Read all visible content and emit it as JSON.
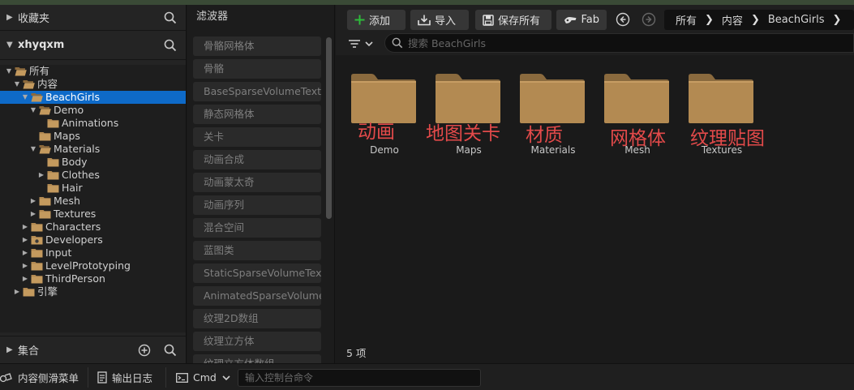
{
  "left_panel": {
    "favorites_title": "收藏夹",
    "project_title": "xhyqxm",
    "collections_title": "集合",
    "tree": [
      {
        "label": "所有",
        "depth": 0,
        "expander": "open",
        "icon": "folder-open-icon"
      },
      {
        "label": "内容",
        "depth": 1,
        "expander": "open",
        "icon": "folder-open-icon"
      },
      {
        "label": "BeachGirls",
        "depth": 2,
        "expander": "open",
        "icon": "folder-open-icon",
        "selected": true
      },
      {
        "label": "Demo",
        "depth": 3,
        "expander": "open",
        "icon": "folder-open-icon"
      },
      {
        "label": "Animations",
        "depth": 4,
        "expander": "none",
        "icon": "folder-icon"
      },
      {
        "label": "Maps",
        "depth": 3,
        "expander": "none",
        "icon": "folder-icon"
      },
      {
        "label": "Materials",
        "depth": 3,
        "expander": "open",
        "icon": "folder-open-icon"
      },
      {
        "label": "Body",
        "depth": 4,
        "expander": "none",
        "icon": "folder-icon"
      },
      {
        "label": "Clothes",
        "depth": 4,
        "expander": "closed",
        "icon": "folder-icon"
      },
      {
        "label": "Hair",
        "depth": 4,
        "expander": "none",
        "icon": "folder-icon"
      },
      {
        "label": "Mesh",
        "depth": 3,
        "expander": "closed",
        "icon": "folder-icon"
      },
      {
        "label": "Textures",
        "depth": 3,
        "expander": "closed",
        "icon": "folder-icon"
      },
      {
        "label": "Characters",
        "depth": 2,
        "expander": "closed",
        "icon": "folder-icon"
      },
      {
        "label": "Developers",
        "depth": 2,
        "expander": "closed",
        "icon": "folder-developer-icon"
      },
      {
        "label": "Input",
        "depth": 2,
        "expander": "closed",
        "icon": "folder-icon"
      },
      {
        "label": "LevelPrototyping",
        "depth": 2,
        "expander": "closed",
        "icon": "folder-icon"
      },
      {
        "label": "ThirdPerson",
        "depth": 2,
        "expander": "closed",
        "icon": "folder-icon"
      },
      {
        "label": "引擎",
        "depth": 1,
        "expander": "closed",
        "icon": "folder-icon"
      }
    ]
  },
  "filter_panel": {
    "title": "滤波器",
    "items": [
      "骨骼网格体",
      "骨骼",
      "BaseSparseVolumeTexture",
      "静态网格体",
      "关卡",
      "动画合成",
      "动画蒙太奇",
      "动画序列",
      "混合空间",
      "蓝图类",
      "StaticSparseVolumeTexture",
      "AnimatedSparseVolumeTexture",
      "纹理2D数组",
      "纹理立方体",
      "纹理立方体数组"
    ]
  },
  "toolbar": {
    "add_label": "添加",
    "import_label": "导入",
    "save_all_label": "保存所有",
    "fab_label": "Fab",
    "breadcrumb": [
      "所有",
      "内容",
      "BeachGirls"
    ]
  },
  "search": {
    "placeholder": "搜索 BeachGirls"
  },
  "assets": [
    {
      "name": "Demo",
      "annotation": "动画"
    },
    {
      "name": "Maps",
      "annotation": "地图关卡"
    },
    {
      "name": "Materials",
      "annotation": "材质"
    },
    {
      "name": "Mesh",
      "annotation": "网格体"
    },
    {
      "name": "Textures",
      "annotation": "纹理贴图"
    }
  ],
  "item_count": "5 项",
  "statusbar": {
    "drawer_label": "内容侧滑菜单",
    "output_log_label": "输出日志",
    "cmd_label": "Cmd",
    "console_placeholder": "输入控制台命令"
  },
  "colors": {
    "accent_green": "#2dbb3a",
    "selection_blue": "#0e6ac8",
    "folder_tan": "#b38a52",
    "annotation_red": "#e34a4a"
  }
}
